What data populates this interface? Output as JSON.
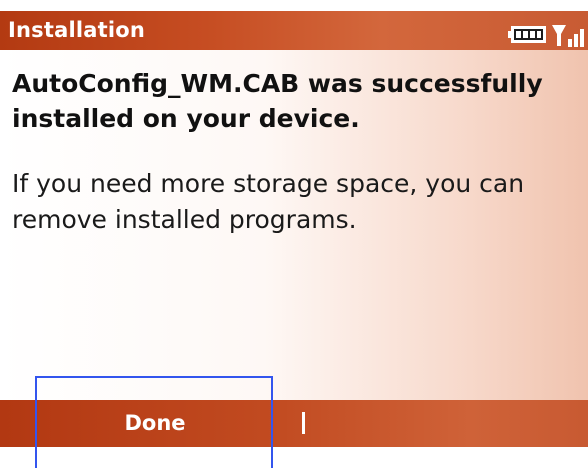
{
  "title_bar": {
    "title": "Installation",
    "battery_icon": "battery-full-icon",
    "signal_icon": "signal-strength-icon"
  },
  "message": {
    "headline": "AutoConfig_WM.CAB was successfully installed on your device.",
    "body": "If you need more storage space, you can remove installed programs."
  },
  "softkeys": {
    "left_label": "Done",
    "right_label": ""
  },
  "colors": {
    "title_bar": "#c64d22",
    "softkey_bar": "#c14a20",
    "highlight_box": "#3355ee"
  }
}
